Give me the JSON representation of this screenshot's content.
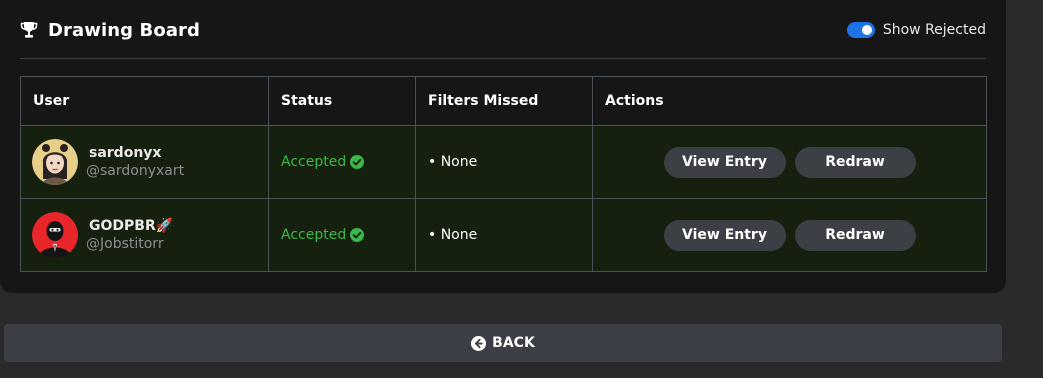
{
  "header": {
    "title": "Drawing Board",
    "title_icon": "trophy-icon",
    "toggle_label": "Show Rejected",
    "toggle_on": true
  },
  "table": {
    "columns": [
      "User",
      "Status",
      "Filters Missed",
      "Actions"
    ],
    "rows": [
      {
        "username": "sardonyx",
        "handle": "@sardonyxart",
        "status": "Accepted",
        "filters_missed": "• None",
        "actions": [
          "View Entry",
          "Redraw"
        ]
      },
      {
        "username": "GODPBR🚀",
        "handle": "@Jobstitorr",
        "status": "Accepted",
        "filters_missed": "• None",
        "actions": [
          "View Entry",
          "Redraw"
        ]
      }
    ]
  },
  "footer": {
    "back_label": "BACK",
    "back_icon": "arrow-left-circle-icon"
  },
  "colors": {
    "accent": "#1e73e6",
    "accepted": "#3cb84a",
    "row_bg": "#15200f",
    "button_bg": "#3c3f45"
  }
}
